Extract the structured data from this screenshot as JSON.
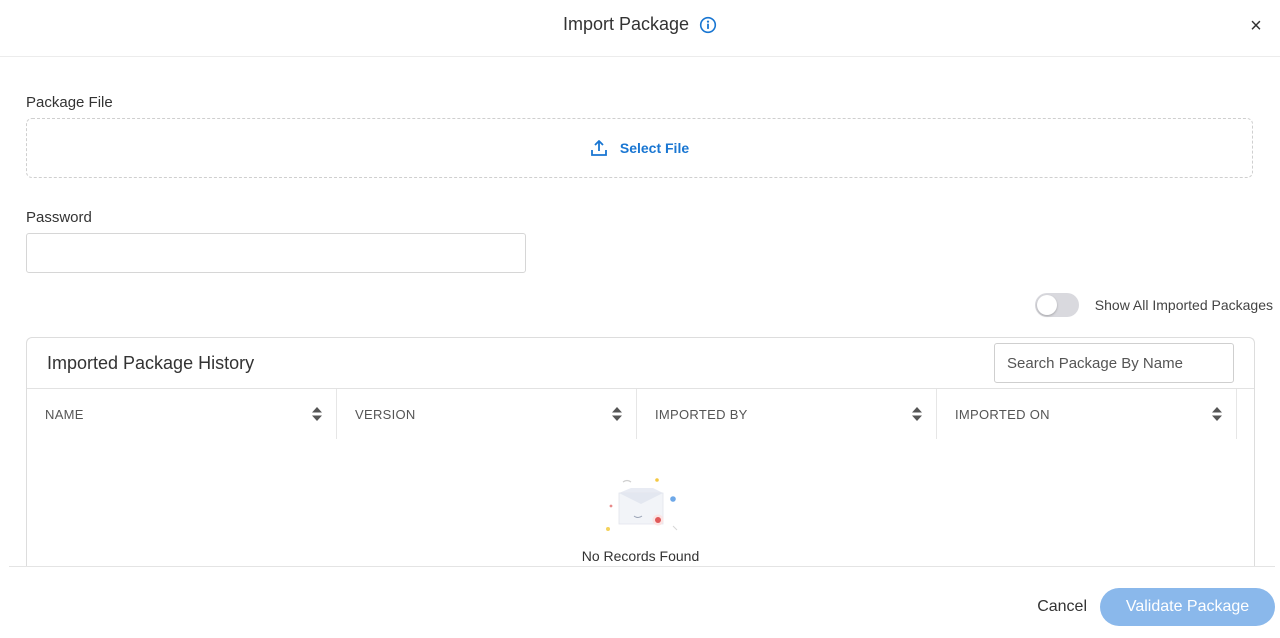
{
  "header": {
    "title": "Import Package",
    "close_label": "×",
    "accent_color": "#1976d2"
  },
  "package_file": {
    "label": "Package File",
    "select_label": "Select File",
    "icon": "upload-icon"
  },
  "password": {
    "label": "Password",
    "value": "",
    "placeholder": ""
  },
  "toggle": {
    "label": "Show All Imported Packages",
    "checked": false
  },
  "history": {
    "title": "Imported Package History",
    "search_placeholder": "Search Package By Name",
    "columns": [
      "NAME",
      "VERSION",
      "IMPORTED BY",
      "IMPORTED ON"
    ],
    "rows": [],
    "empty_text": "No Records Found"
  },
  "footer": {
    "cancel_label": "Cancel",
    "validate_label": "Validate Package",
    "validate_color": "#8ab8eb"
  }
}
